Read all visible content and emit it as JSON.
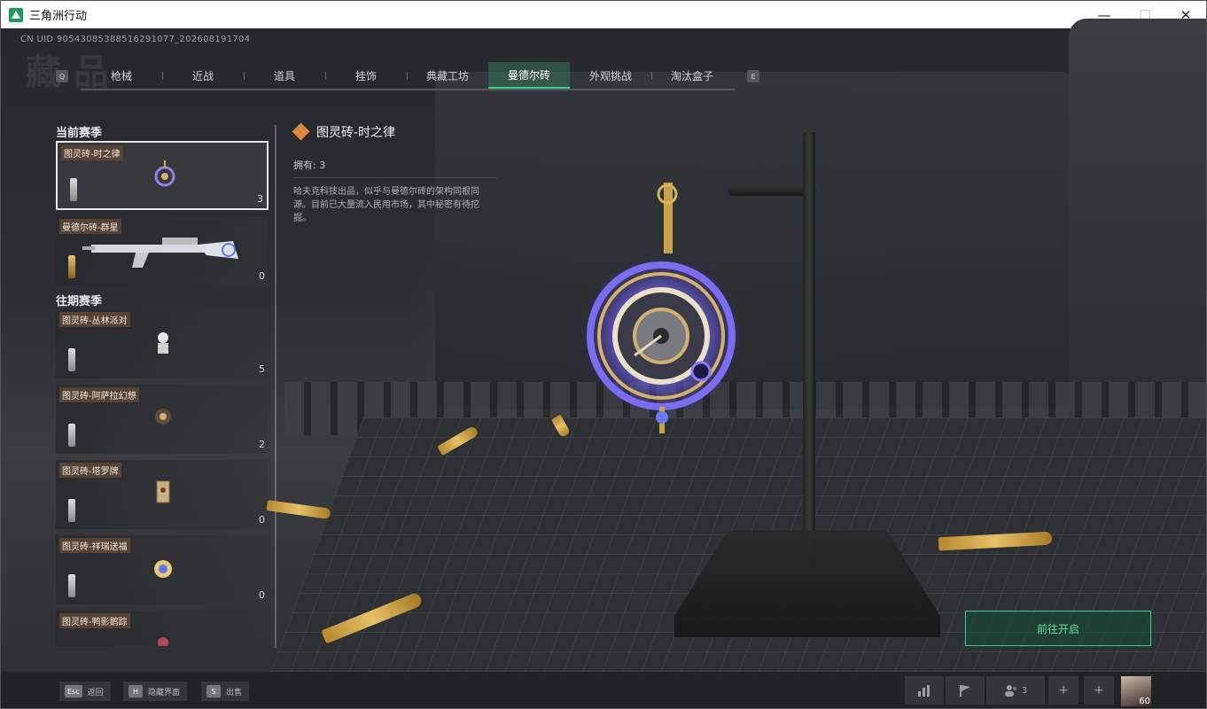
{
  "window": {
    "title": "三角洲行动",
    "minimize": "—",
    "maximize": "☐",
    "close": "✕"
  },
  "uid": "CN UID 9054308538851629​1077_202608191704",
  "tabs": {
    "key_left": "Q",
    "key_right": "E",
    "items": [
      "枪械",
      "近战",
      "道具",
      "挂饰",
      "典藏工坊",
      "曼德尔砖",
      "外观挑战",
      "淘汰盒子"
    ],
    "active_index": 5
  },
  "left": {
    "current_season": "当前赛季",
    "past_season": "往期赛季",
    "current_items": [
      {
        "name": "图灵砖-时之律",
        "count": "3"
      },
      {
        "name": "曼德尔砖-群星",
        "count": "0"
      }
    ],
    "past_items": [
      {
        "name": "图灵砖-丛林派对",
        "count": "5"
      },
      {
        "name": "图灵砖-阿萨拉幻想",
        "count": "2"
      },
      {
        "name": "图灵砖-塔罗牌",
        "count": "0"
      },
      {
        "name": "图灵砖-祥瑞送福",
        "count": "0"
      },
      {
        "name": "图灵砖-鸭影鹅踪",
        "count": "..."
      }
    ]
  },
  "detail": {
    "title": "图灵砖-时之律",
    "owned": "拥有: 3",
    "description": "哈夫克科技出品，似乎与曼德尔砖的架构同根同源。目前已大量流入民用市场，其中秘密有待挖掘。"
  },
  "action_button": "前往开启",
  "footer": {
    "hints": [
      {
        "key": "Esc",
        "label": "返回"
      },
      {
        "key": "H",
        "label": "隐藏界面"
      },
      {
        "key": "S",
        "label": "出售"
      }
    ],
    "team_count": "3",
    "level": "60"
  },
  "colors": {
    "accent_green": "#3ccf8e",
    "rarity_orange": "#e08a3c"
  }
}
